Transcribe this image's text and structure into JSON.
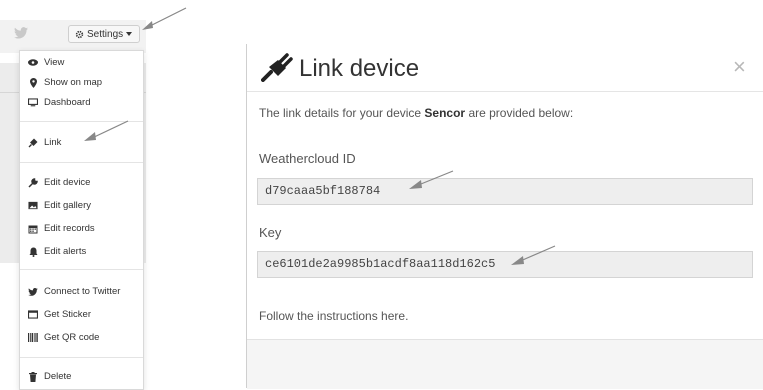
{
  "settings": {
    "label": "Settings"
  },
  "menu": {
    "items": [
      {
        "label": "View",
        "icon": "eye-icon"
      },
      {
        "label": "Show on map",
        "icon": "map-marker-icon"
      },
      {
        "label": "Dashboard",
        "icon": "monitor-icon"
      },
      {
        "label": "Link",
        "icon": "plug-icon"
      },
      {
        "label": "Edit device",
        "icon": "wrench-icon"
      },
      {
        "label": "Edit gallery",
        "icon": "picture-icon"
      },
      {
        "label": "Edit records",
        "icon": "calendar-icon"
      },
      {
        "label": "Edit alerts",
        "icon": "bell-icon"
      },
      {
        "label": "Connect to Twitter",
        "icon": "twitter-icon"
      },
      {
        "label": "Get Sticker",
        "icon": "sticker-icon"
      },
      {
        "label": "Get QR code",
        "icon": "qr-code-icon"
      },
      {
        "label": "Delete",
        "icon": "trash-icon"
      }
    ]
  },
  "modal": {
    "title": "Link device",
    "close": "×",
    "intro_prefix": "The link details for your device ",
    "device_name": "Sencor",
    "intro_suffix": " are provided below:",
    "id_label": "Weathercloud ID",
    "id_value": "d79caaa5bf188784",
    "key_label": "Key",
    "key_value": "ce6101de2a9985b1acdf8aa118d162c5",
    "follow_text": "Follow the instructions here."
  },
  "colors": {
    "arrow": "#888888",
    "field_bg": "#eeeeee"
  }
}
